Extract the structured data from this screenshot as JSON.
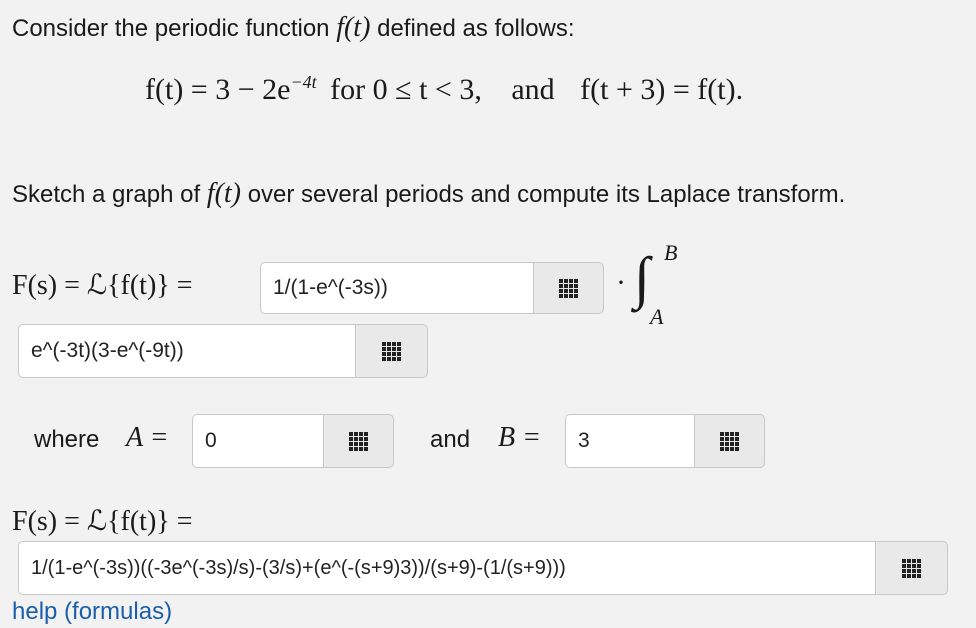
{
  "intro_text": "Consider the periodic function",
  "intro_fn": "f(t)",
  "intro_rest": "defined as follows:",
  "definition": {
    "lhs": "f(t) = 3 − 2e",
    "exp": "−4t",
    "condition": "for 0 ≤ t < 3,",
    "and_word": "and",
    "periodicity": "f(t + 3) = f(t)."
  },
  "sketch_text_a": "Sketch a graph of",
  "sketch_fn": "f(t)",
  "sketch_text_b": "over several periods and compute its Laplace transform.",
  "laplace_label": "F(s) = ℒ{f(t)} =",
  "input_factor": {
    "value": "1/(1-e^(-3s))"
  },
  "dot": "·",
  "integral": {
    "sign": "∫",
    "upper": "B",
    "lower": "A"
  },
  "input_integrand": {
    "value": "e^(-3t)(3-e^(-9t))"
  },
  "where_label": "where",
  "a_label": "A =",
  "input_a": {
    "value": "0"
  },
  "and_label": "and",
  "b_label": "B =",
  "input_b": {
    "value": "3"
  },
  "laplace_label_2": "F(s) = ℒ{f(t)} =",
  "input_final": {
    "value": "1/(1-e^(-3s))((-3e^(-3s)/s)-(3/s)+(e^(-(s+9)3))/(s+9)-(1/(s+9)))"
  },
  "help_link": "help (formulas)",
  "icon": "grid-keypad-icon"
}
